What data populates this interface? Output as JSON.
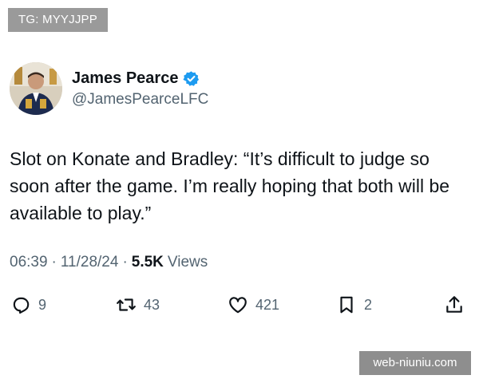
{
  "watermarks": {
    "top": "TG: MYYJJPP",
    "bottom": "web-niuniu.com"
  },
  "colors": {
    "verified": "#1d9bf0",
    "text_primary": "#0f1419",
    "text_secondary": "#536471"
  },
  "author": {
    "display_name": "James Pearce",
    "handle": "@JamesPearceLFC",
    "avatar_icon": "profile-photo",
    "verified_icon": "verified-badge-icon"
  },
  "tweet": {
    "text": "Slot on Konate and Bradley: “It’s difficult to judge so soon after the game. I’m really hoping that both will be available to play.”"
  },
  "meta": {
    "time": "06:39",
    "date": "11/28/24",
    "views_count": "5.5K",
    "views_label": "Views",
    "separator": "·"
  },
  "actions": {
    "replies": "9",
    "retweets": "43",
    "likes": "421",
    "bookmarks": "2"
  }
}
